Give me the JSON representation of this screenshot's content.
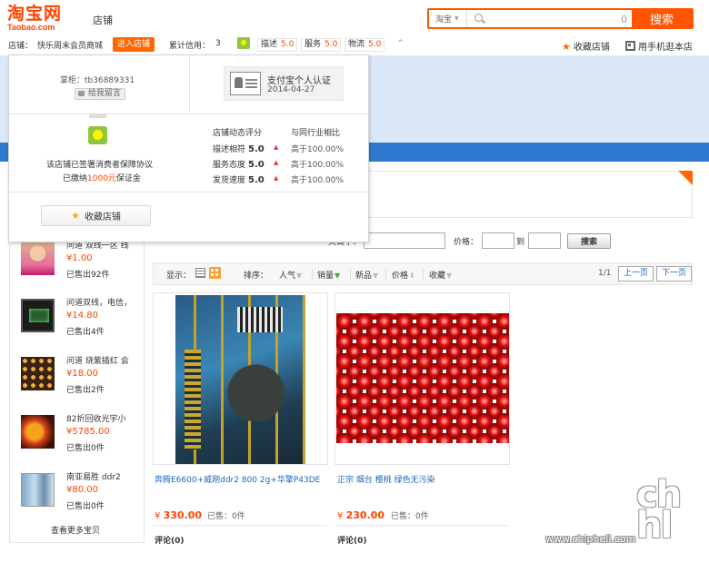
{
  "header": {
    "logo_cn": "淘宝网",
    "logo_en": "Taobao.com",
    "store_label": "店铺",
    "search_scope": "淘宝",
    "search_button": "搜索"
  },
  "infobar": {
    "store_prefix": "店铺：",
    "store_name": "快乐周末会员商城",
    "enter_store": "进入店铺",
    "credit_label": "累计信用：",
    "credit_value": "3",
    "dsr": [
      {
        "label": "描述",
        "score": "5.0"
      },
      {
        "label": "服务",
        "score": "5.0"
      },
      {
        "label": "物流",
        "score": "5.0"
      }
    ],
    "caret": "^",
    "favorite": "收藏店铺",
    "mobile": "用手机逛本店"
  },
  "popup": {
    "keeper": "掌柜：tb36889331",
    "leave_message": "给我留言",
    "cert_title": "支付宝个人认证",
    "cert_date": "2014-04-27",
    "sign_line1": "该店铺已签署消费者保障协议",
    "sign_prefix": "已缴纳",
    "sign_amount": "1000元",
    "sign_suffix": "保证金",
    "dsr_title": "店铺动态评分",
    "compare_title": "与同行业相比",
    "rows": [
      {
        "label": "描述相符",
        "score": "5.0",
        "compare": "高于100.00%"
      },
      {
        "label": "服务态度",
        "score": "5.0",
        "compare": "高于100.00%"
      },
      {
        "label": "发货速度",
        "score": "5.0",
        "compare": "高于100.00%"
      }
    ],
    "favorite_button": "收藏店铺"
  },
  "sidebar": {
    "items": [
      {
        "title": "问道 双线一区 线",
        "price": "¥1.00",
        "sold_prefix": "已售出",
        "sold": "92",
        "sold_suffix": "件"
      },
      {
        "title": "问道双线，电信，",
        "price": "¥14.80",
        "sold_prefix": "已售出",
        "sold": "4",
        "sold_suffix": "件"
      },
      {
        "title": "问道 烧紫插红 会",
        "price": "¥18.00",
        "sold_prefix": "已售出",
        "sold": "2",
        "sold_suffix": "件"
      },
      {
        "title": "82折回收光宇小",
        "price": "¥5785.00",
        "sold_prefix": "已售出",
        "sold": "0",
        "sold_suffix": "件"
      },
      {
        "title": "南亚易胜 ddr2",
        "price": "¥80.00",
        "sold_prefix": "已售出",
        "sold": "0",
        "sold_suffix": "件"
      }
    ],
    "more": "查看更多宝贝"
  },
  "filter": {
    "keyword_label": "关键字：",
    "price_label": "价格：",
    "to_label": "到",
    "search_button": "搜索"
  },
  "sortbar": {
    "display_label": "显示：",
    "sort_label": "排序：",
    "popularity": "人气",
    "sales": "销量",
    "new": "新品",
    "price": "价格",
    "favorites": "收藏",
    "page_count": "1/1",
    "prev": "上一页",
    "next": "下一页"
  },
  "products": [
    {
      "title": "奔腾E6600+威刚ddr2 800 2g+华擎P43DE",
      "price_symbol": "¥",
      "price": "330.00",
      "sold_label": "已售：",
      "sold": "0件",
      "review_label": "评论",
      "reviews": "(0)"
    },
    {
      "title": "正宗 烟台 樱桃 绿色无污染",
      "price_symbol": "¥",
      "price": "230.00",
      "sold_label": "已售：",
      "sold": "0件",
      "review_label": "评论",
      "reviews": "(0)"
    }
  ],
  "watermark": {
    "logo": "chip hell",
    "url": "www.chiphell.com"
  },
  "colors": {
    "brand": "#ff5500",
    "price": "#ff4400",
    "nav": "#2e79cf",
    "link": "#1c65c2"
  }
}
